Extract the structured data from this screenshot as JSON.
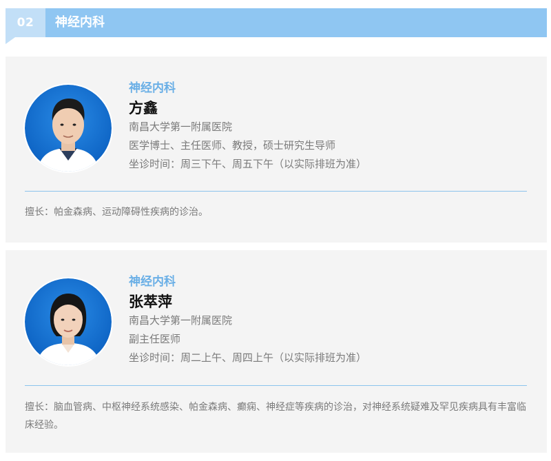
{
  "section": {
    "number": "02",
    "title": "神经内科"
  },
  "colors": {
    "header_bar": "#8fc6f2",
    "number_box": "#c2dff7",
    "accent_text": "#6aafe6",
    "card_bg": "#f4f4f4",
    "divider": "#8bc3ec"
  },
  "doctors": [
    {
      "department": "神经内科",
      "name": "方鑫",
      "hospital": "南昌大学第一附属医院",
      "titles": "医学博士、主任医师、教授，硕士研究生导师",
      "clinic_time": "坐诊时间：周三下午、周五下午（以实际排班为准）",
      "specialty": "擅长：帕金森病、运动障碍性疾病的诊治。",
      "avatar_icon": "doctor-portrait-male"
    },
    {
      "department": "神经内科",
      "name": "张萃萍",
      "hospital": "南昌大学第一附属医院",
      "titles": "副主任医师",
      "clinic_time": "坐诊时间：周二上午、周四上午（以实际排班为准）",
      "specialty": "擅长：脑血管病、中枢神经系统感染、帕金森病、癫痫、神经症等疾病的诊治，对神经系统疑难及罕见疾病具有丰富临床经验。",
      "avatar_icon": "doctor-portrait-female"
    }
  ]
}
